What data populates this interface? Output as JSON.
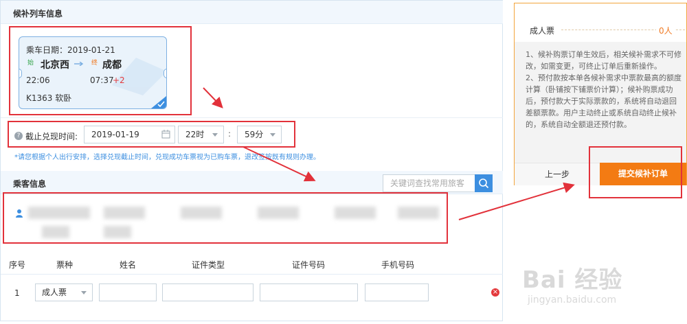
{
  "train_section": {
    "title": "候补列车信息",
    "ticket": {
      "date_label": "乘车日期：2019-01-21",
      "start_tag": "始",
      "end_tag": "终",
      "from_station": "北京西",
      "to_station": "成都",
      "depart_time": "22:06",
      "arrive_time": "07:37",
      "arrive_plus": "+2",
      "train_seat": "K1363  软卧"
    }
  },
  "deadline": {
    "label": "截止兑现时间:",
    "date": "2019-01-19",
    "hour": "22时",
    "colon": ":",
    "minute": "59分",
    "notice": "*请您根据个人出行安排，选择兑现截止时间，兑现成功车票视为已购车票，退改签按既有规则办理。"
  },
  "passenger_section": {
    "title": "乘客信息",
    "search_placeholder": "关键词查找常用旅客"
  },
  "table": {
    "headers": [
      "序号",
      "票种",
      "姓名",
      "证件类型",
      "证件号码",
      "手机号码"
    ],
    "rows": [
      {
        "index": "1",
        "ticket_type": "成人票"
      }
    ]
  },
  "side_panel": {
    "adult_label": "成人票",
    "adult_count": "0人",
    "note1": "1、候补购票订单生效后，相关候补需求不可修改，如需变更，可终止订单后重新操作。",
    "note2": "2、预付款按本单各候补需求中票款最高的额度计算（卧铺按下铺票价计算）；候补购票成功后，预付款大于实际票款的，系统将自动退回差额票款。用户主动终止或系统自动终止候补的，系统自动全额退还预付款。",
    "prev_button": "上一步",
    "submit_button": "提交候补订单"
  },
  "watermark": {
    "brand": "Bai 经验",
    "url": "jingyan.baidu.com"
  },
  "colors": {
    "accent_blue": "#3d8fe0",
    "accent_orange": "#f37b13",
    "annotation_red": "#e2313a"
  }
}
